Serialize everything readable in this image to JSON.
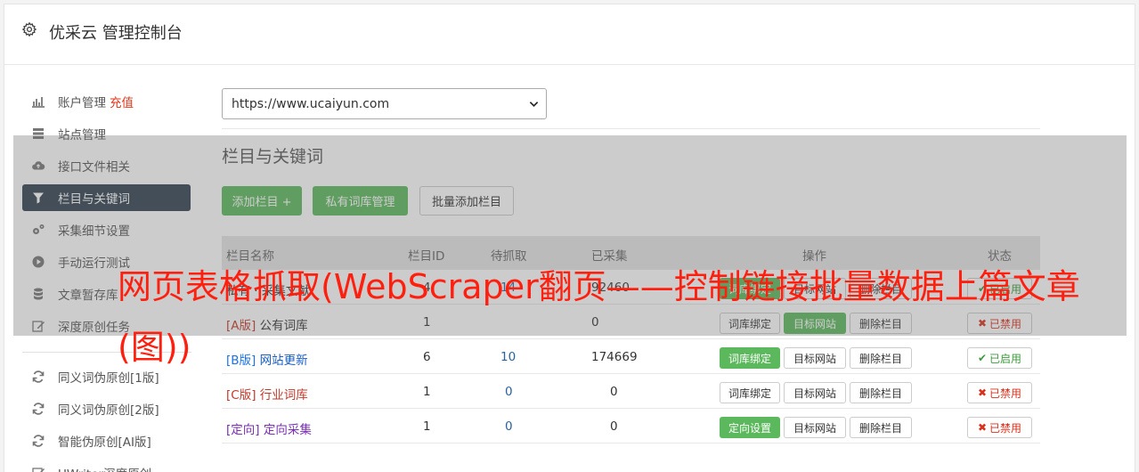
{
  "app": {
    "title": "优采云 管理控制台",
    "icon": "gear-icon"
  },
  "sidebar": {
    "items": [
      {
        "label": "账户管理",
        "extra": "充值",
        "icon": "bar-chart-icon"
      },
      {
        "label": "站点管理",
        "icon": "server-icon"
      },
      {
        "label": "接口文件相关",
        "icon": "cloud-upload-icon"
      },
      {
        "label": "栏目与关键词",
        "icon": "filter-icon",
        "active": true
      },
      {
        "label": "采集细节设置",
        "icon": "cogs-icon"
      },
      {
        "label": "手动运行测试",
        "icon": "play-circle-icon"
      },
      {
        "label": "文章暂存库",
        "icon": "database-icon"
      },
      {
        "label": "深度原创任务",
        "icon": "edit-icon"
      },
      {
        "label": "同义词伪原创[1版]",
        "icon": "refresh-icon"
      },
      {
        "label": "同义词伪原创[2版]",
        "icon": "refresh-icon"
      },
      {
        "label": "智能伪原创[AI版]",
        "icon": "refresh-icon"
      },
      {
        "label": "UWriter深度原创",
        "icon": "edit-icon"
      }
    ]
  },
  "site_select": {
    "value": "https://www.ucaiyun.com"
  },
  "section": {
    "title": "栏目与关键词"
  },
  "toolbar": {
    "add_column": "添加栏目 +",
    "private_lib": "私有词库管理",
    "batch_add": "批量添加栏目"
  },
  "table": {
    "headers": [
      "栏目名称",
      "栏目ID",
      "待抓取",
      "已采集",
      "操作",
      "状态"
    ],
    "rows": [
      {
        "tag": "",
        "name": "私有 · 采集文献",
        "id": "4",
        "pending": "14",
        "collected": "92460",
        "ops": [
          "词库绑定",
          "目标网站",
          "删除栏目"
        ],
        "status": "已启用"
      },
      {
        "tag": "[A版]",
        "name": "公有词库",
        "id": "1",
        "pending": "",
        "collected": "0",
        "ops": [
          "词库绑定",
          "目标网站",
          "删除栏目"
        ],
        "status": "已禁用"
      },
      {
        "tag": "[B版]",
        "name": "网站更新",
        "id": "6",
        "pending": "10",
        "collected": "174669",
        "ops": [
          "词库绑定",
          "目标网站",
          "删除栏目"
        ],
        "status": "已启用"
      },
      {
        "tag": "[C版]",
        "name": "行业词库",
        "id": "1",
        "pending": "0",
        "collected": "0",
        "ops": [
          "词库绑定",
          "目标网站",
          "删除栏目"
        ],
        "status": "已禁用"
      },
      {
        "tag": "[定向]",
        "name": "定向采集",
        "id": "1",
        "pending": "0",
        "collected": "0",
        "ops": [
          "定向设置",
          "目标网站",
          "删除栏目"
        ],
        "status": "已禁用"
      }
    ]
  },
  "headline": "网页表格抓取(WebScraper翻页——控制链接批量数据上篇文章(图))",
  "colors": {
    "sidebar_active": "#2f4050",
    "green": "#5cb85c",
    "headline": "#ff1f0f",
    "danger": "#d9301c"
  }
}
